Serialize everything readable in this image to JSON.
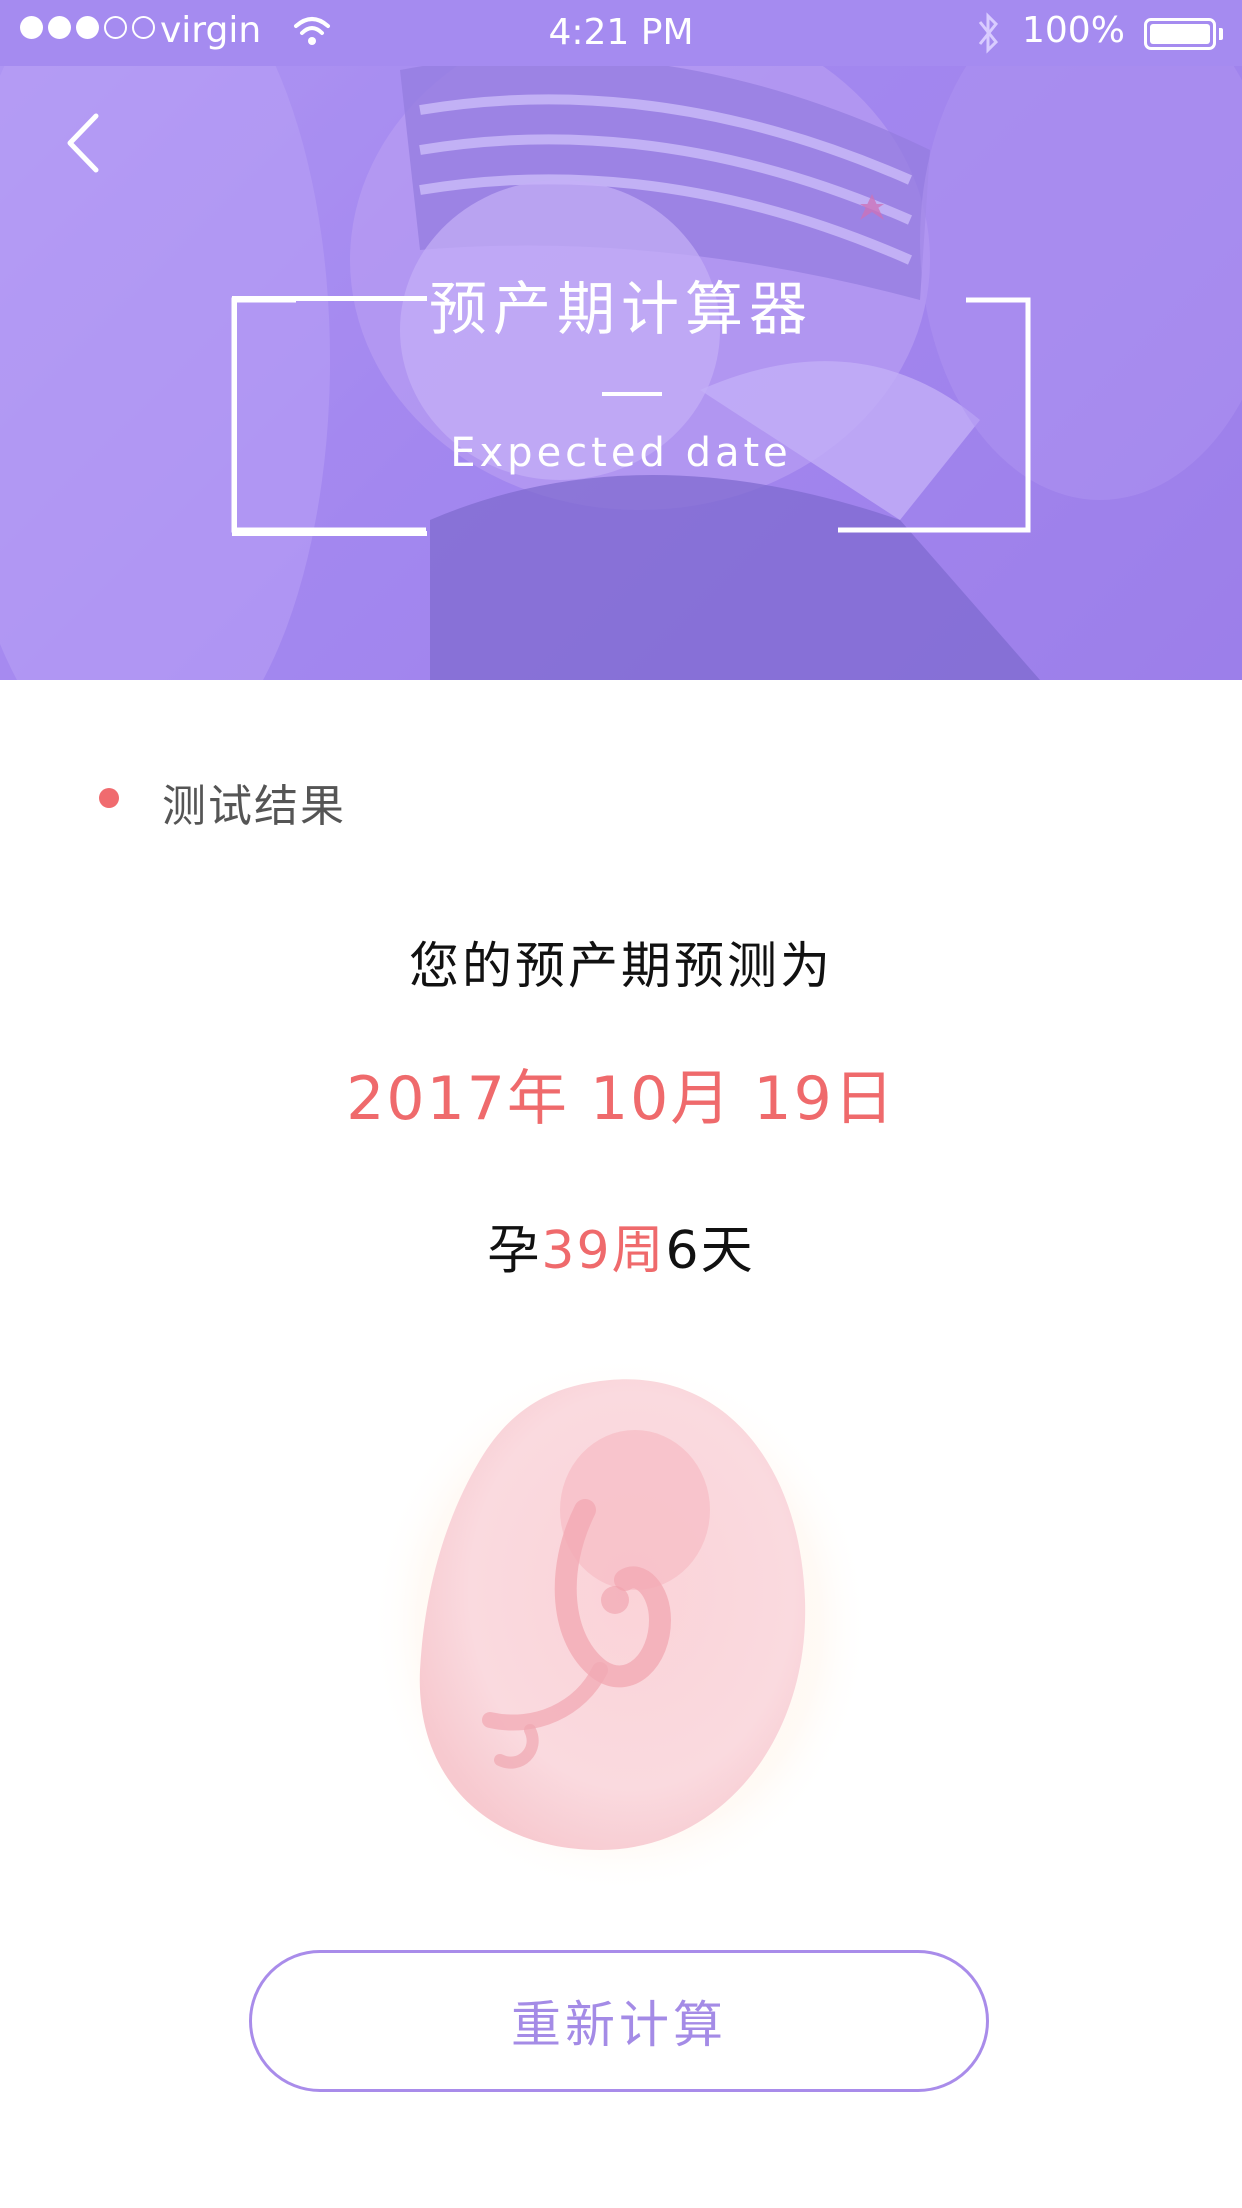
{
  "status_bar": {
    "carrier": "virgin",
    "time": "4:21 PM",
    "battery": "100%",
    "signal_filled": 3,
    "signal_total": 5
  },
  "header": {
    "back_icon": "chevron-left-icon",
    "title": "预产期计算器",
    "subtitle": "Expected date"
  },
  "result": {
    "section_label": "测试结果",
    "caption": "您的预产期预测为",
    "date": "2017年 10月 19日",
    "weeks_prefix": "孕",
    "weeks_value": "39周",
    "days_value": "6天"
  },
  "actions": {
    "recalculate_label": "重新计算"
  },
  "colors": {
    "brand_purple": "#a58bf0",
    "accent_red": "#ef6a6c",
    "button_border": "#a98cea"
  }
}
